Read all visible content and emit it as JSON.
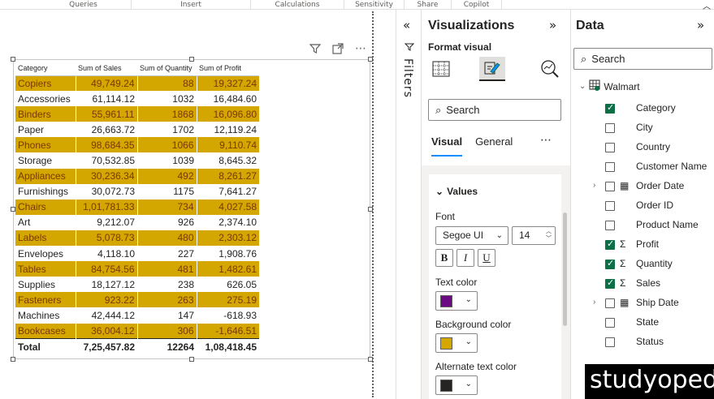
{
  "ribbon": {
    "groups": [
      "Queries",
      "Insert",
      "Calculations",
      "Sensitivity",
      "Share",
      "Copilot"
    ]
  },
  "table_visual": {
    "headers": [
      "Category",
      "Sum of Sales",
      "Sum of Quantity",
      "Sum of Profit"
    ],
    "rows": [
      {
        "category": "Copiers",
        "sales": "49,749.24",
        "quantity": "88",
        "profit": "19,327.24",
        "highlight": true
      },
      {
        "category": "Accessories",
        "sales": "61,114.12",
        "quantity": "1032",
        "profit": "16,484.60",
        "highlight": false
      },
      {
        "category": "Binders",
        "sales": "55,961.11",
        "quantity": "1868",
        "profit": "16,096.80",
        "highlight": true
      },
      {
        "category": "Paper",
        "sales": "26,663.72",
        "quantity": "1702",
        "profit": "12,119.24",
        "highlight": false
      },
      {
        "category": "Phones",
        "sales": "98,684.35",
        "quantity": "1066",
        "profit": "9,110.74",
        "highlight": true
      },
      {
        "category": "Storage",
        "sales": "70,532.85",
        "quantity": "1039",
        "profit": "8,645.32",
        "highlight": false
      },
      {
        "category": "Appliances",
        "sales": "30,236.34",
        "quantity": "492",
        "profit": "8,261.27",
        "highlight": true
      },
      {
        "category": "Furnishings",
        "sales": "30,072.73",
        "quantity": "1175",
        "profit": "7,641.27",
        "highlight": false
      },
      {
        "category": "Chairs",
        "sales": "1,01,781.33",
        "quantity": "734",
        "profit": "4,027.58",
        "highlight": true
      },
      {
        "category": "Art",
        "sales": "9,212.07",
        "quantity": "926",
        "profit": "2,374.10",
        "highlight": false
      },
      {
        "category": "Labels",
        "sales": "5,078.73",
        "quantity": "480",
        "profit": "2,303.12",
        "highlight": true
      },
      {
        "category": "Envelopes",
        "sales": "4,118.10",
        "quantity": "227",
        "profit": "1,908.76",
        "highlight": false
      },
      {
        "category": "Tables",
        "sales": "84,754.56",
        "quantity": "481",
        "profit": "1,482.61",
        "highlight": true
      },
      {
        "category": "Supplies",
        "sales": "18,127.12",
        "quantity": "238",
        "profit": "626.05",
        "highlight": false
      },
      {
        "category": "Fasteners",
        "sales": "923.22",
        "quantity": "263",
        "profit": "275.19",
        "highlight": true
      },
      {
        "category": "Machines",
        "sales": "42,444.12",
        "quantity": "147",
        "profit": "-618.93",
        "highlight": false
      },
      {
        "category": "Bookcases",
        "sales": "36,004.12",
        "quantity": "306",
        "profit": "-1,646.51",
        "highlight": true
      }
    ],
    "total": {
      "label": "Total",
      "sales": "7,25,457.82",
      "quantity": "12264",
      "profit": "1,08,418.45"
    },
    "highlight_color": "#d4a600",
    "highlight_text_color": "#7a3800"
  },
  "filters": {
    "label": "Filters"
  },
  "visualizations": {
    "title": "Visualizations",
    "subtitle": "Format visual",
    "search_placeholder": "Search",
    "tabs": [
      "Visual",
      "General"
    ],
    "active_tab": "Visual",
    "section_title": "Values",
    "font_label": "Font",
    "font_family": "Segoe UI",
    "font_size": "14",
    "format_buttons": [
      "B",
      "I",
      "U"
    ],
    "text_color_label": "Text color",
    "text_color": "#6b0a82",
    "background_color_label": "Background color",
    "background_color": "#d4a600",
    "alt_text_color_label": "Alternate text color",
    "alt_text_color": "#252423"
  },
  "data_pane": {
    "title": "Data",
    "search_placeholder": "Search",
    "table_name": "Walmart",
    "fields": [
      {
        "name": "Category",
        "checked": true,
        "icon": "",
        "expandable": false
      },
      {
        "name": "City",
        "checked": false,
        "icon": "",
        "expandable": false
      },
      {
        "name": "Country",
        "checked": false,
        "icon": "",
        "expandable": false
      },
      {
        "name": "Customer Name",
        "checked": false,
        "icon": "",
        "expandable": false
      },
      {
        "name": "Order Date",
        "checked": false,
        "icon": "calendar-icon",
        "expandable": true
      },
      {
        "name": "Order ID",
        "checked": false,
        "icon": "",
        "expandable": false
      },
      {
        "name": "Product Name",
        "checked": false,
        "icon": "",
        "expandable": false
      },
      {
        "name": "Profit",
        "checked": true,
        "icon": "sigma-icon",
        "expandable": false
      },
      {
        "name": "Quantity",
        "checked": true,
        "icon": "sigma-icon",
        "expandable": false
      },
      {
        "name": "Sales",
        "checked": true,
        "icon": "sigma-icon",
        "expandable": false
      },
      {
        "name": "Ship Date",
        "checked": false,
        "icon": "calendar-icon",
        "expandable": true
      },
      {
        "name": "State",
        "checked": false,
        "icon": "",
        "expandable": false
      },
      {
        "name": "Status",
        "checked": false,
        "icon": "",
        "expandable": false
      }
    ]
  },
  "watermark": {
    "text": "studyopedia"
  }
}
